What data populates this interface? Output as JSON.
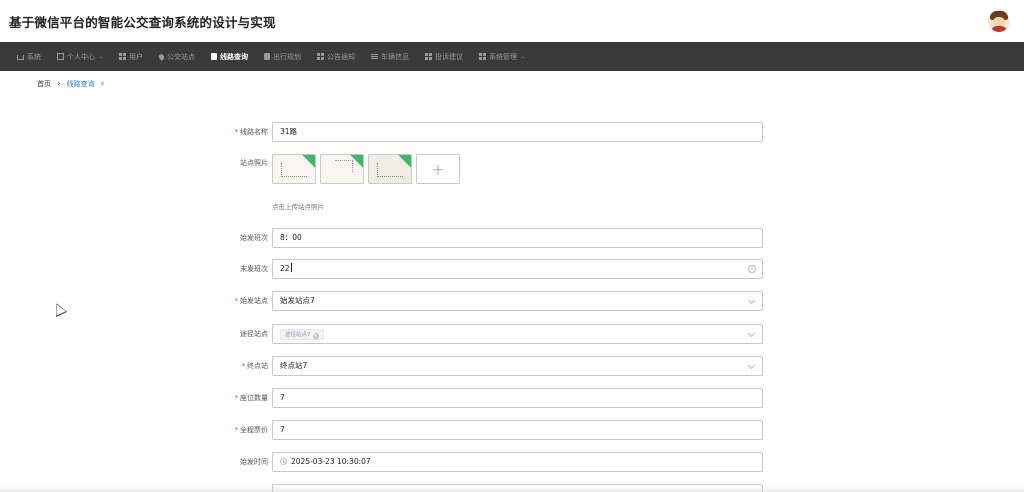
{
  "header": {
    "title": "基于微信平台的智能公交查询系统的设计与实现",
    "avatar_icon": "user-avatar-icon"
  },
  "nav": {
    "items": [
      {
        "label": "系统",
        "icon": "home-icon",
        "active": false,
        "dropdown": false
      },
      {
        "label": "个人中心",
        "icon": "box-icon",
        "active": false,
        "dropdown": true
      },
      {
        "label": "用户",
        "icon": "grid-icon",
        "active": false,
        "dropdown": false
      },
      {
        "label": "公交站点",
        "icon": "pin-icon",
        "active": false,
        "dropdown": false
      },
      {
        "label": "线路查询",
        "icon": "doc-icon",
        "active": true,
        "dropdown": false
      },
      {
        "label": "出行规划",
        "icon": "doc-icon",
        "active": false,
        "dropdown": false
      },
      {
        "label": "公告通知",
        "icon": "grid-icon",
        "active": false,
        "dropdown": false
      },
      {
        "label": "车辆信息",
        "icon": "list-icon",
        "active": false,
        "dropdown": false
      },
      {
        "label": "投诉建议",
        "icon": "grid-icon",
        "active": false,
        "dropdown": false
      },
      {
        "label": "系统管理",
        "icon": "grid-icon",
        "active": false,
        "dropdown": true
      }
    ]
  },
  "breadcrumb": {
    "home": "首页",
    "separator": "›",
    "current": "线路查询",
    "trailing": "›"
  },
  "form": {
    "route_name": {
      "label": "线路名称",
      "required": true,
      "value": "31路"
    },
    "photos": {
      "label": "站点照片",
      "hint": "点击上传站点照片",
      "add_symbol": "+",
      "count": 3
    },
    "first_bus": {
      "label": "始发班次",
      "value": "8：00"
    },
    "last_bus": {
      "label": "末发班次",
      "value": "22"
    },
    "start_station": {
      "label": "始发站点",
      "required": true,
      "value": "始发站点7"
    },
    "via_stations": {
      "label": "途径站点",
      "tags": [
        "途径站点7"
      ]
    },
    "end_station": {
      "label": "终点站",
      "required": true,
      "value": "终点站7"
    },
    "seats": {
      "label": "座位数量",
      "required": true,
      "value": "7"
    },
    "fare": {
      "label": "全程票价",
      "required": true,
      "value": "7"
    },
    "depart_time": {
      "label": "始发时间",
      "value": "2025-03-23 10:30:07"
    }
  },
  "colors": {
    "navbar_bg": "#3a3a3a",
    "active_link": "#1e88c8",
    "required_mark": "#e53935",
    "thumb_badge": "#3cb86a"
  }
}
